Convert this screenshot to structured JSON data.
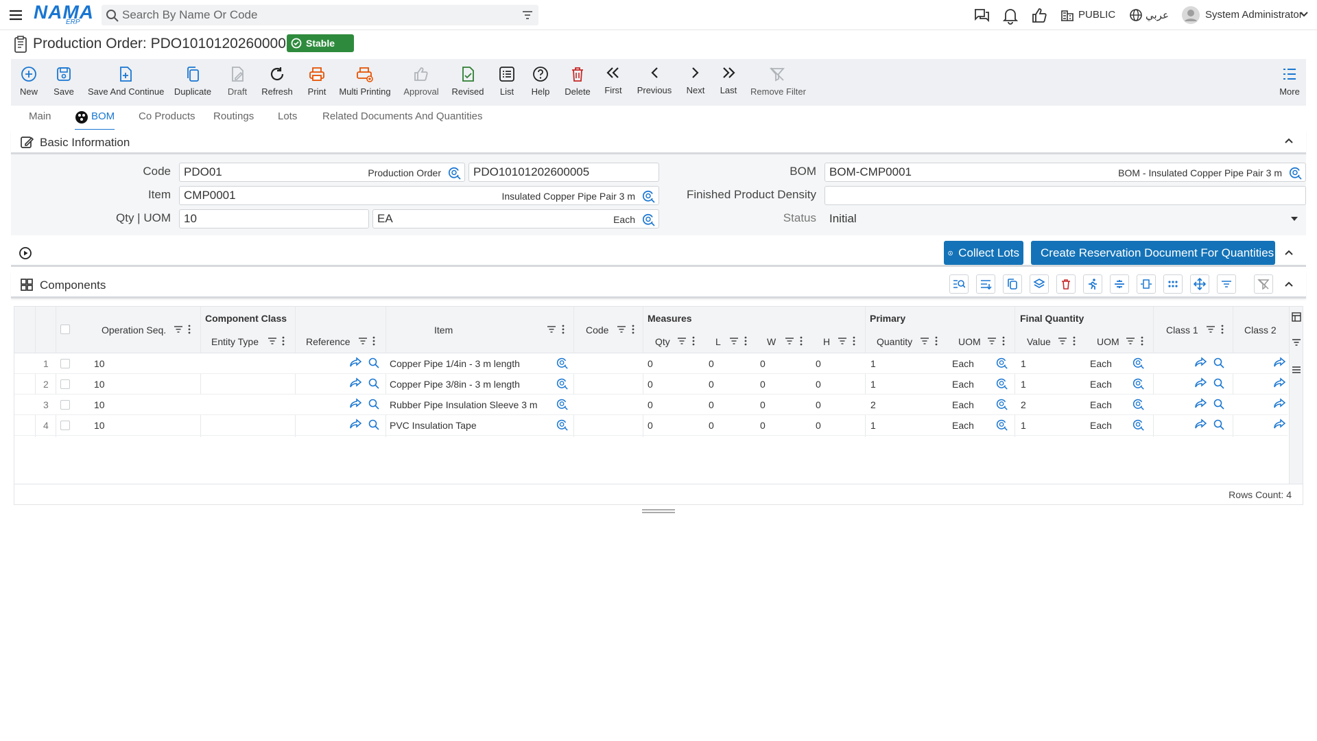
{
  "topbar": {
    "logo_text": "NAMA",
    "logo_sub": "ERP",
    "search_placeholder": "Search By Name Or Code",
    "public_label": "PUBLIC",
    "language_label": "عربي",
    "user_name": "System Administrator"
  },
  "title": {
    "text": "Production Order: PDO10101202600005",
    "badge": "Stable"
  },
  "toolbar": {
    "new": "New",
    "save": "Save",
    "save_continue": "Save And Continue",
    "duplicate": "Duplicate",
    "draft": "Draft",
    "refresh": "Refresh",
    "print": "Print",
    "multi_printing": "Multi Printing",
    "approval": "Approval",
    "revised": "Revised",
    "list": "List",
    "help": "Help",
    "delete": "Delete",
    "first": "First",
    "previous": "Previous",
    "next": "Next",
    "last": "Last",
    "remove_filter": "Remove Filter",
    "more": "More"
  },
  "tabs": [
    "Main",
    "BOM",
    "Co Products",
    "Routings",
    "Lots",
    "Related Documents And Quantities"
  ],
  "basic_info": {
    "title": "Basic Information",
    "code_label": "Code",
    "code_value": "PDO01",
    "code_hint": "Production Order",
    "code_number": "PDO10101202600005",
    "item_label": "Item",
    "item_value": "CMP0001",
    "item_hint": "Insulated Copper Pipe Pair 3 m",
    "qty_label": "Qty | UOM",
    "qty_value": "10",
    "uom_value": "EA",
    "uom_hint": "Each",
    "bom_label": "BOM",
    "bom_value": "BOM-CMP0001",
    "bom_hint": "BOM - Insulated Copper Pipe Pair 3 m",
    "density_label": "Finished Product Density",
    "density_value": "",
    "status_label": "Status",
    "status_value": "Initial"
  },
  "actions": {
    "collect_lots": "Collect Lots",
    "create_reservation": "Create Reservation Document For Quantities"
  },
  "components": {
    "title": "Components",
    "headers": {
      "operation_seq": "Operation Seq.",
      "component_class": "Component Class",
      "entity_type": "Entity Type",
      "reference": "Reference",
      "item": "Item",
      "code": "Code",
      "measures": "Measures",
      "qty": "Qty",
      "l": "L",
      "w": "W",
      "h": "H",
      "primary": "Primary",
      "quantity": "Quantity",
      "uom": "UOM",
      "final_quantity": "Final Quantity",
      "value": "Value",
      "final_uom": "UOM",
      "class1": "Class 1",
      "class2": "Class 2"
    },
    "rows": [
      {
        "n": "1",
        "op": "10",
        "item": "Copper Pipe 1/4in - 3 m length",
        "qty": "0",
        "l": "0",
        "w": "0",
        "h": "0",
        "quantity": "1",
        "uom": "Each",
        "value": "1",
        "final_uom": "Each"
      },
      {
        "n": "2",
        "op": "10",
        "item": "Copper Pipe 3/8in - 3 m length",
        "qty": "0",
        "l": "0",
        "w": "0",
        "h": "0",
        "quantity": "1",
        "uom": "Each",
        "value": "1",
        "final_uom": "Each"
      },
      {
        "n": "3",
        "op": "10",
        "item": "Rubber Pipe Insulation Sleeve 3 m",
        "qty": "0",
        "l": "0",
        "w": "0",
        "h": "0",
        "quantity": "2",
        "uom": "Each",
        "value": "2",
        "final_uom": "Each"
      },
      {
        "n": "4",
        "op": "10",
        "item": "PVC Insulation Tape",
        "qty": "0",
        "l": "0",
        "w": "0",
        "h": "0",
        "quantity": "1",
        "uom": "Each",
        "value": "1",
        "final_uom": "Each"
      }
    ],
    "rows_count": "Rows Count: 4"
  },
  "colors": {
    "accent": "#1976d2",
    "action_blue": "#1473b8",
    "stable_green": "#2e8b3d",
    "delete_red": "#c62828",
    "print_orange": "#e65100"
  }
}
